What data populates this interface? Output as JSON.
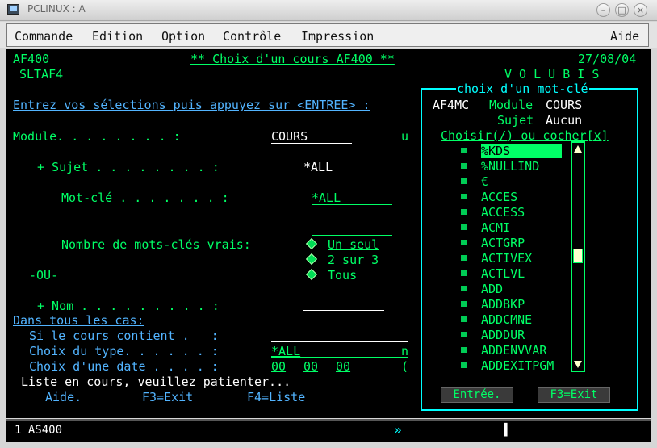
{
  "window": {
    "title": "PCLINUX : A"
  },
  "menu": {
    "items": [
      "Commande",
      "Edition",
      "Option",
      "Contrôle",
      "Impression"
    ],
    "help": "Aide"
  },
  "screen": {
    "program": "AF400",
    "program2": "SLTAF4",
    "title": "** Choix d'un cours AF400 **",
    "date": "27/08/04",
    "brand": "V O L U B I S",
    "instructions": "Entrez vos sélections puis appuyez sur <ENTREE> :",
    "module_label": "Module. . . . . . . . :",
    "module_value": "COURS",
    "module_trailing": "u",
    "sujet_label": "+ Sujet . . . . . . . . :",
    "sujet_value": "*ALL",
    "motcle_label": "Mot-clé . . . . . . . :",
    "motcle_value": "*ALL",
    "nombre_label": "Nombre de mots-clés vrais:",
    "options": [
      "Un seul",
      "2 sur 3",
      "Tous"
    ],
    "ou_label": "-OU-",
    "nom_label": "+ Nom . . . . . . . . . :",
    "dans_label": "Dans tous les cas:",
    "contient_label": "Si le cours contient .   :",
    "type_label": "Choix du type. . . . . . :",
    "type_value": "*ALL",
    "type_trailing": "n",
    "date_label": "Choix d'une date . . . . :",
    "date_values": [
      "00",
      "00",
      "00"
    ],
    "date_trailing": "(",
    "status_message": "Liste en cours, veuillez patienter...",
    "fkeys": [
      "Aide.",
      "F3=Exit",
      "F4=Liste"
    ]
  },
  "popup": {
    "title": "choix d'un mot-clé",
    "program": "AF4MC",
    "module_label": "Module",
    "module_value": "COURS",
    "sujet_label": "Sujet",
    "sujet_value": "Aucun",
    "instruction": "Choisir(/) ou cocher[x]",
    "items": [
      "%KDS",
      "%NULLIND",
      "€",
      "ACCES",
      "ACCESS",
      "ACMI",
      "ACTGRP",
      "ACTIVEX",
      "ACTLVL",
      "ADD",
      "ADDBKP",
      "ADDCMNE",
      "ADDDUR",
      "ADDENVVAR",
      "ADDEXITPGM"
    ],
    "selected_index": 0,
    "buttons": [
      "Entrée.",
      "F3=Exit"
    ]
  },
  "statusbar": {
    "session": "1 AS400",
    "middle": "»",
    "right": "▐"
  },
  "colors": {
    "background": "#000000",
    "green": "#00ff66",
    "white": "#ffffff",
    "blue": "#52b4ff",
    "cyan": "#00ffff"
  }
}
